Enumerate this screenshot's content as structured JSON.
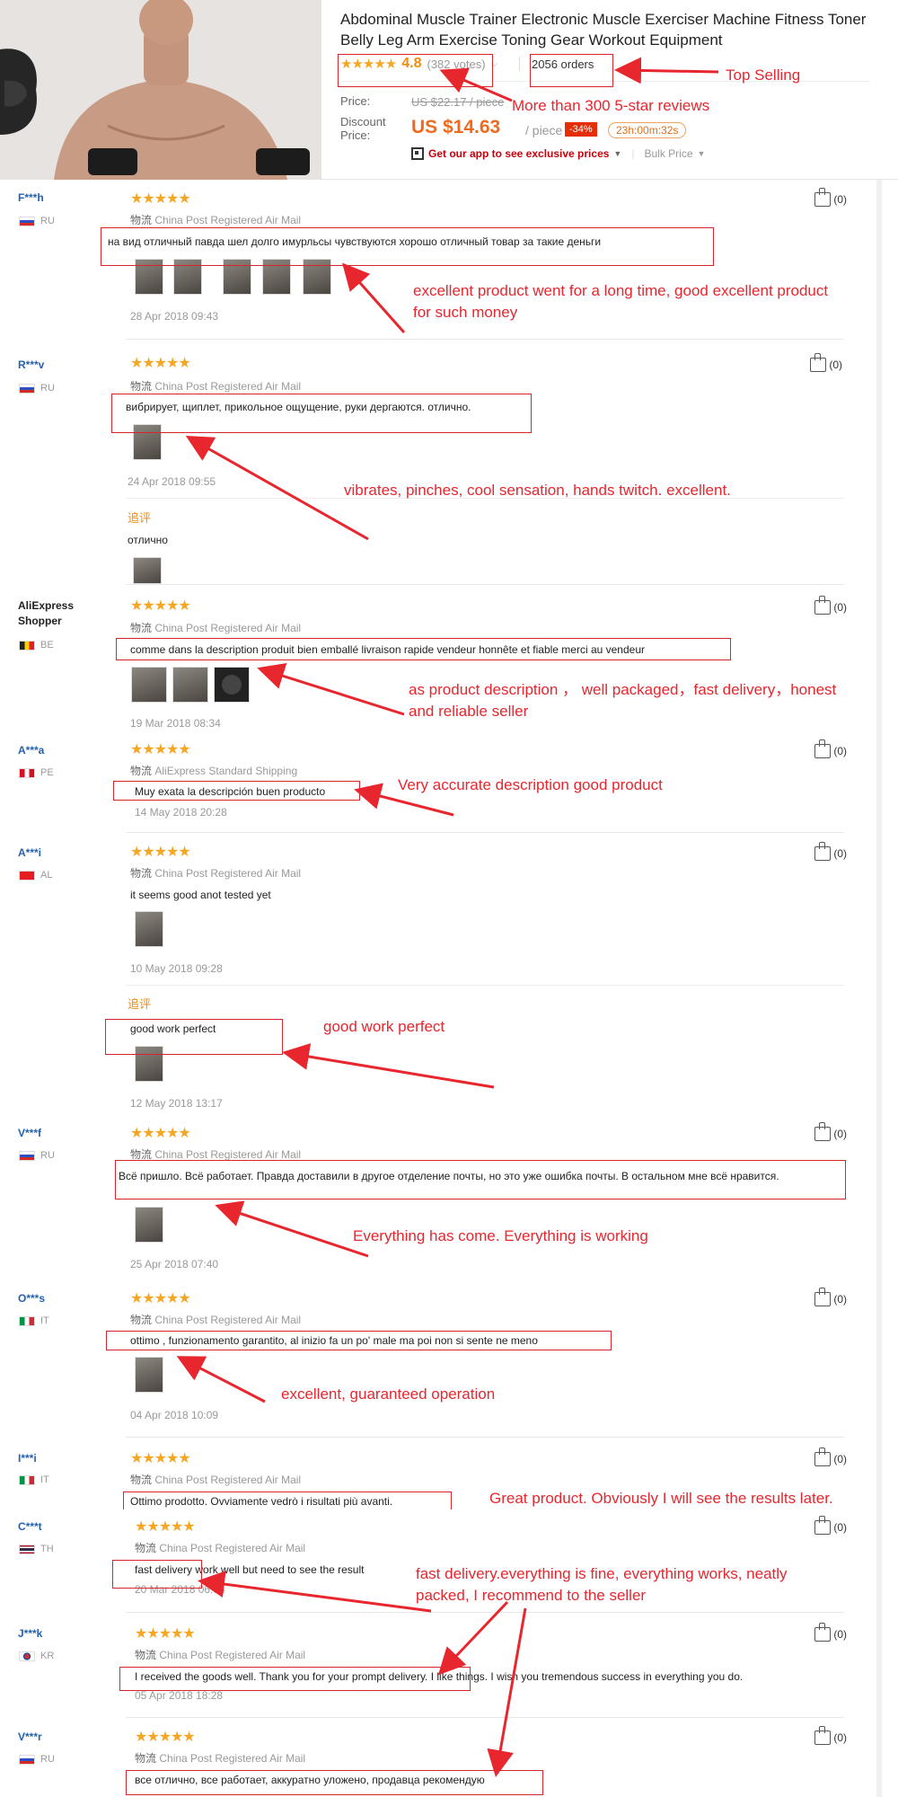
{
  "header": {
    "title": "Abdominal Muscle Trainer Electronic Muscle Exerciser Machine Fitness Toner Belly Leg Arm Exercise Toning Gear Workout Equipment",
    "stars": "★★★★★",
    "rating": "4.8",
    "votes": "(382 votes)",
    "orders": "2056 orders",
    "price_label": "Price:",
    "old_price": "US $22.17 / piece",
    "discount_label": "Discount Price:",
    "current_price": "US $14.63",
    "per_piece": "/ piece",
    "discount_badge": "-34%",
    "timer": "23h:00m:32s",
    "app_text": "Get our app to see exclusive prices",
    "bulk_price": "Bulk Price"
  },
  "annotations": {
    "top_selling": "Top Selling",
    "five_star": "More than 300 5-star reviews",
    "r1": "excellent product went for a long time, good excellent product for such money",
    "r2": "vibrates, pinches, cool sensation, hands twitch. excellent.",
    "r3": "as product description ， well packaged，fast delivery，honest and reliable seller",
    "r4": "Very accurate description good product",
    "r5": "good work perfect",
    "r6": "Everything has come. Everything is working",
    "r7": "excellent, guaranteed operation",
    "r8": "Great product. Obviously I will see the results later.",
    "r9": "fast delivery.everything is fine, everything works, neatly packed, I recommend to the seller"
  },
  "review_common": {
    "stars": "★★★★★",
    "ship_prefix": "物流",
    "likes": "(0)",
    "follow_label": "追评"
  },
  "reviews": [
    {
      "name": "F***h",
      "country": "RU",
      "shipping": "China Post Registered Air Mail",
      "text": "на вид отличный павда шел долго имурльсы чувствуются хорошо отличный товар за такие деньги",
      "date": "28 Apr 2018 09:43"
    },
    {
      "name": "R***v",
      "country": "RU",
      "shipping": "China Post Registered Air Mail",
      "text": "вибрирует, щиплет, прикольное ощущение, руки дергаются. отлично.",
      "date": "24 Apr 2018 09:55",
      "follow": "отлично"
    },
    {
      "name": "AliExpress Shopper",
      "country": "BE",
      "shipping": "China Post Registered Air Mail",
      "text": "comme dans la description produit bien emballé livraison rapide vendeur honnête et fiable merci au vendeur",
      "date": "19 Mar 2018 08:34"
    },
    {
      "name": "A***a",
      "country": "PE",
      "shipping": "AliExpress Standard Shipping",
      "text": "Muy exata la descripción buen producto",
      "date": "14 May 2018 20:28"
    },
    {
      "name": "A***i",
      "country": "AL",
      "shipping": "China Post Registered Air Mail",
      "text": "it seems good anot tested yet",
      "date": "10 May 2018 09:28",
      "follow": "good work perfect",
      "follow_date": "12 May 2018 13:17"
    },
    {
      "name": "V***f",
      "country": "RU",
      "shipping": "China Post Registered Air Mail",
      "text": "Всё пришло. Всё работает. Правда доставили в другое отделение почты, но это уже ошибка почты. В остальном мне всё нравится.",
      "date": "25 Apr 2018 07:40"
    },
    {
      "name": "O***s",
      "country": "IT",
      "shipping": "China Post Registered Air Mail",
      "text": "ottimo , funzionamento garantito, al inizio fa un po' male ma poi non si sente ne meno",
      "date": "04 Apr 2018 10:09"
    },
    {
      "name": "I***i",
      "country": "IT",
      "shipping": "China Post Registered Air Mail",
      "text": "Ottimo prodotto. Ovviamente vedrò i risultati più avanti."
    },
    {
      "name": "C***t",
      "country": "TH",
      "shipping": "China Post Registered Air Mail",
      "text": "fast delivery work well but need to see the result",
      "date": "20 Mar 2018 06:04"
    },
    {
      "name": "J***k",
      "country": "KR",
      "shipping": "China Post Registered Air Mail",
      "text": "I received the goods well. Thank you for your prompt delivery. I like things. I wish you tremendous success in everything you do.",
      "date": "05 Apr 2018 18:28"
    },
    {
      "name": "V***r",
      "country": "RU",
      "shipping": "China Post Registered Air Mail",
      "text": "все отлично, все работает, аккуратно уложено, продавца рекомендую"
    }
  ]
}
